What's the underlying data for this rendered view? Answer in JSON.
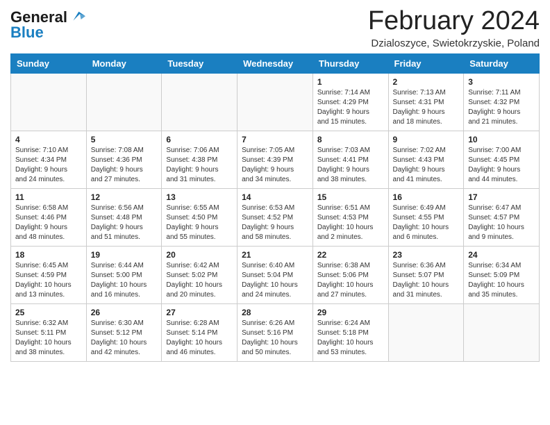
{
  "header": {
    "logo_line1": "General",
    "logo_line2": "Blue",
    "month": "February 2024",
    "location": "Dzialoszyce, Swietokrzyskie, Poland"
  },
  "days_of_week": [
    "Sunday",
    "Monday",
    "Tuesday",
    "Wednesday",
    "Thursday",
    "Friday",
    "Saturday"
  ],
  "weeks": [
    [
      {
        "day": "",
        "info": ""
      },
      {
        "day": "",
        "info": ""
      },
      {
        "day": "",
        "info": ""
      },
      {
        "day": "",
        "info": ""
      },
      {
        "day": "1",
        "info": "Sunrise: 7:14 AM\nSunset: 4:29 PM\nDaylight: 9 hours\nand 15 minutes."
      },
      {
        "day": "2",
        "info": "Sunrise: 7:13 AM\nSunset: 4:31 PM\nDaylight: 9 hours\nand 18 minutes."
      },
      {
        "day": "3",
        "info": "Sunrise: 7:11 AM\nSunset: 4:32 PM\nDaylight: 9 hours\nand 21 minutes."
      }
    ],
    [
      {
        "day": "4",
        "info": "Sunrise: 7:10 AM\nSunset: 4:34 PM\nDaylight: 9 hours\nand 24 minutes."
      },
      {
        "day": "5",
        "info": "Sunrise: 7:08 AM\nSunset: 4:36 PM\nDaylight: 9 hours\nand 27 minutes."
      },
      {
        "day": "6",
        "info": "Sunrise: 7:06 AM\nSunset: 4:38 PM\nDaylight: 9 hours\nand 31 minutes."
      },
      {
        "day": "7",
        "info": "Sunrise: 7:05 AM\nSunset: 4:39 PM\nDaylight: 9 hours\nand 34 minutes."
      },
      {
        "day": "8",
        "info": "Sunrise: 7:03 AM\nSunset: 4:41 PM\nDaylight: 9 hours\nand 38 minutes."
      },
      {
        "day": "9",
        "info": "Sunrise: 7:02 AM\nSunset: 4:43 PM\nDaylight: 9 hours\nand 41 minutes."
      },
      {
        "day": "10",
        "info": "Sunrise: 7:00 AM\nSunset: 4:45 PM\nDaylight: 9 hours\nand 44 minutes."
      }
    ],
    [
      {
        "day": "11",
        "info": "Sunrise: 6:58 AM\nSunset: 4:46 PM\nDaylight: 9 hours\nand 48 minutes."
      },
      {
        "day": "12",
        "info": "Sunrise: 6:56 AM\nSunset: 4:48 PM\nDaylight: 9 hours\nand 51 minutes."
      },
      {
        "day": "13",
        "info": "Sunrise: 6:55 AM\nSunset: 4:50 PM\nDaylight: 9 hours\nand 55 minutes."
      },
      {
        "day": "14",
        "info": "Sunrise: 6:53 AM\nSunset: 4:52 PM\nDaylight: 9 hours\nand 58 minutes."
      },
      {
        "day": "15",
        "info": "Sunrise: 6:51 AM\nSunset: 4:53 PM\nDaylight: 10 hours\nand 2 minutes."
      },
      {
        "day": "16",
        "info": "Sunrise: 6:49 AM\nSunset: 4:55 PM\nDaylight: 10 hours\nand 6 minutes."
      },
      {
        "day": "17",
        "info": "Sunrise: 6:47 AM\nSunset: 4:57 PM\nDaylight: 10 hours\nand 9 minutes."
      }
    ],
    [
      {
        "day": "18",
        "info": "Sunrise: 6:45 AM\nSunset: 4:59 PM\nDaylight: 10 hours\nand 13 minutes."
      },
      {
        "day": "19",
        "info": "Sunrise: 6:44 AM\nSunset: 5:00 PM\nDaylight: 10 hours\nand 16 minutes."
      },
      {
        "day": "20",
        "info": "Sunrise: 6:42 AM\nSunset: 5:02 PM\nDaylight: 10 hours\nand 20 minutes."
      },
      {
        "day": "21",
        "info": "Sunrise: 6:40 AM\nSunset: 5:04 PM\nDaylight: 10 hours\nand 24 minutes."
      },
      {
        "day": "22",
        "info": "Sunrise: 6:38 AM\nSunset: 5:06 PM\nDaylight: 10 hours\nand 27 minutes."
      },
      {
        "day": "23",
        "info": "Sunrise: 6:36 AM\nSunset: 5:07 PM\nDaylight: 10 hours\nand 31 minutes."
      },
      {
        "day": "24",
        "info": "Sunrise: 6:34 AM\nSunset: 5:09 PM\nDaylight: 10 hours\nand 35 minutes."
      }
    ],
    [
      {
        "day": "25",
        "info": "Sunrise: 6:32 AM\nSunset: 5:11 PM\nDaylight: 10 hours\nand 38 minutes."
      },
      {
        "day": "26",
        "info": "Sunrise: 6:30 AM\nSunset: 5:12 PM\nDaylight: 10 hours\nand 42 minutes."
      },
      {
        "day": "27",
        "info": "Sunrise: 6:28 AM\nSunset: 5:14 PM\nDaylight: 10 hours\nand 46 minutes."
      },
      {
        "day": "28",
        "info": "Sunrise: 6:26 AM\nSunset: 5:16 PM\nDaylight: 10 hours\nand 50 minutes."
      },
      {
        "day": "29",
        "info": "Sunrise: 6:24 AM\nSunset: 5:18 PM\nDaylight: 10 hours\nand 53 minutes."
      },
      {
        "day": "",
        "info": ""
      },
      {
        "day": "",
        "info": ""
      }
    ]
  ]
}
